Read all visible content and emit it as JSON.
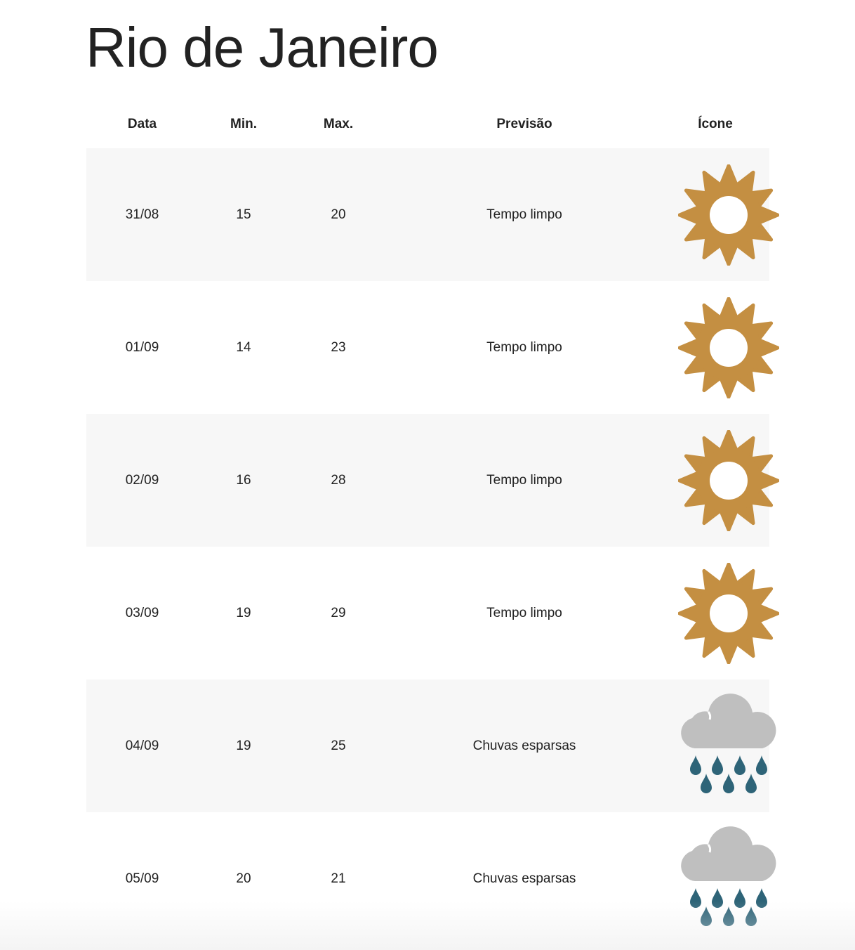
{
  "page": {
    "title": "Rio de Janeiro"
  },
  "table": {
    "headers": {
      "date": "Data",
      "min": "Min.",
      "max": "Max.",
      "forecast": "Previsão",
      "icon": "Ícone"
    },
    "rows": [
      {
        "date": "31/08",
        "min": "15",
        "max": "20",
        "forecast": "Tempo limpo",
        "icon": "sun-icon"
      },
      {
        "date": "01/09",
        "min": "14",
        "max": "23",
        "forecast": "Tempo limpo",
        "icon": "sun-icon"
      },
      {
        "date": "02/09",
        "min": "16",
        "max": "28",
        "forecast": "Tempo limpo",
        "icon": "sun-icon"
      },
      {
        "date": "03/09",
        "min": "19",
        "max": "29",
        "forecast": "Tempo limpo",
        "icon": "sun-icon"
      },
      {
        "date": "04/09",
        "min": "19",
        "max": "25",
        "forecast": "Chuvas esparsas",
        "icon": "rain-cloud-icon"
      },
      {
        "date": "05/09",
        "min": "20",
        "max": "21",
        "forecast": "Chuvas esparsas",
        "icon": "rain-cloud-icon"
      }
    ]
  },
  "colors": {
    "sun": "#c48f42",
    "cloud": "#bfbfbf",
    "rain": "#2e6478",
    "row_stripe": "#f7f7f7"
  }
}
